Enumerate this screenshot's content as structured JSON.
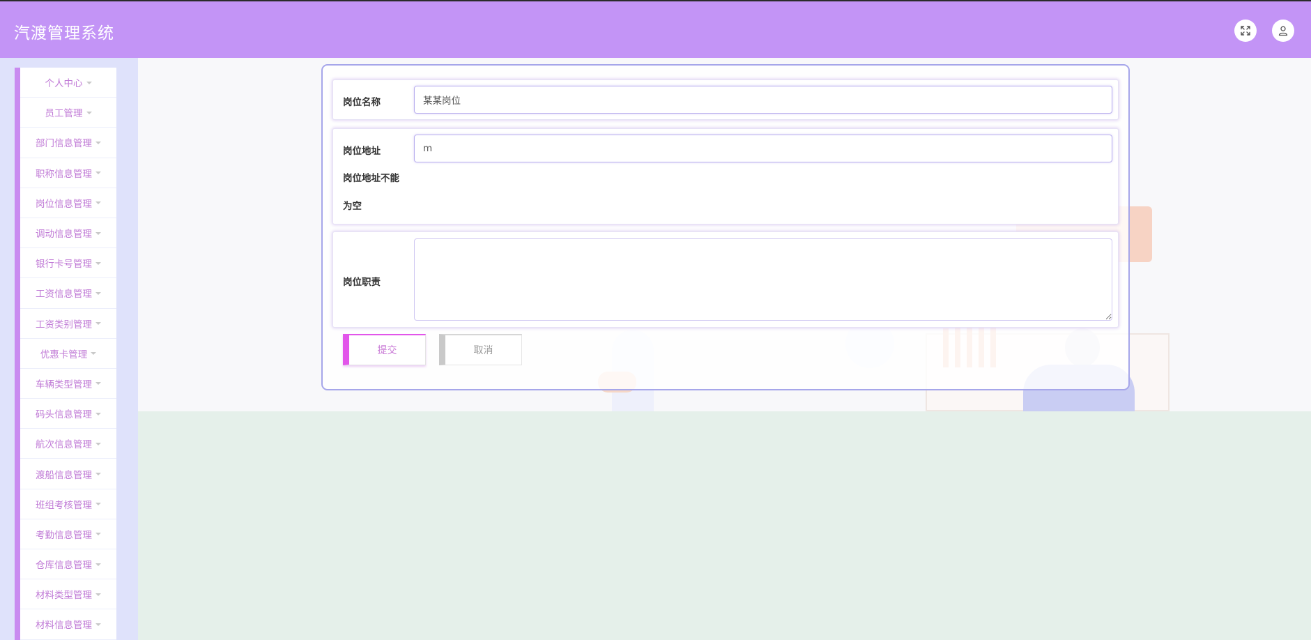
{
  "app": {
    "title": "汽渡管理系统"
  },
  "header": {
    "fullscreen_icon": "fullscreen-icon",
    "user_icon": "user-icon"
  },
  "sidebar": {
    "items": [
      {
        "label": "个人中心"
      },
      {
        "label": "员工管理"
      },
      {
        "label": "部门信息管理"
      },
      {
        "label": "职称信息管理"
      },
      {
        "label": "岗位信息管理"
      },
      {
        "label": "调动信息管理"
      },
      {
        "label": "银行卡号管理"
      },
      {
        "label": "工资信息管理"
      },
      {
        "label": "工资类别管理"
      },
      {
        "label": "优惠卡管理"
      },
      {
        "label": "车辆类型管理"
      },
      {
        "label": "码头信息管理"
      },
      {
        "label": "航次信息管理"
      },
      {
        "label": "渡船信息管理"
      },
      {
        "label": "班组考核管理"
      },
      {
        "label": "考勤信息管理"
      },
      {
        "label": "仓库信息管理"
      },
      {
        "label": "材料类型管理"
      },
      {
        "label": "材料信息管理"
      }
    ]
  },
  "form": {
    "name": {
      "label": "岗位名称",
      "value": "某某岗位"
    },
    "address": {
      "label": "岗位地址",
      "value": "m",
      "error_line1": "岗位地址不能",
      "error_line2": "为空"
    },
    "duty": {
      "label": "岗位职责",
      "value": ""
    },
    "submit_label": "提交",
    "cancel_label": "取消"
  },
  "colors": {
    "header": "#c394f6",
    "accent": "#e255ea",
    "menu_text": "#c07ad6",
    "form_border": "#a6a6ea"
  }
}
